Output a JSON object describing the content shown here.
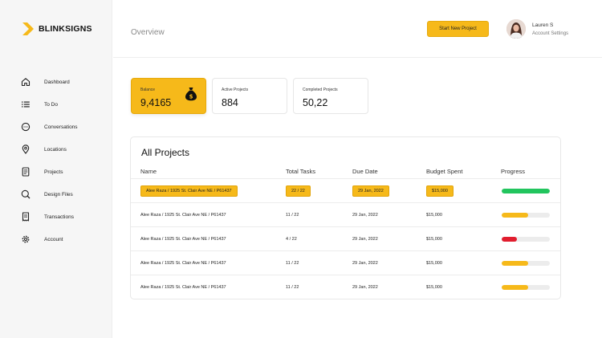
{
  "brand": {
    "name": "BLINKSIGNS",
    "accent": "#f6b91a"
  },
  "sidebar": {
    "items": [
      {
        "label": "Dashboard",
        "icon": "home-icon"
      },
      {
        "label": "To Do",
        "icon": "list-icon"
      },
      {
        "label": "Conversations",
        "icon": "chat-icon"
      },
      {
        "label": "Locations",
        "icon": "location-pin-icon"
      },
      {
        "label": "Projects",
        "icon": "document-icon"
      },
      {
        "label": "Design Files",
        "icon": "file-search-icon"
      },
      {
        "label": "Transactions",
        "icon": "receipt-icon"
      },
      {
        "label": "Account",
        "icon": "gear-icon"
      }
    ]
  },
  "header": {
    "title": "Overview",
    "start_button": "Start New Project",
    "user_name": "Lauren S",
    "user_sub": "Account Settings"
  },
  "stats": {
    "balance": {
      "label": "Balance",
      "value": "9,4165"
    },
    "active": {
      "label": "Active Projects",
      "value": "884"
    },
    "completed": {
      "label": "Completed Projects",
      "value": "50,22"
    }
  },
  "projects": {
    "title": "All Projects",
    "columns": [
      "Name",
      "Total Tasks",
      "Due Date",
      "Budget Spent",
      "Progress"
    ],
    "rows": [
      {
        "name": "Alee Raza / 1925 St. Clair Ave NE / P61437",
        "tasks": "22 / 22",
        "due": "29 Jan, 2022",
        "budget": "$15,000",
        "progress": 1.0,
        "color": "#22c55e",
        "highlight": true
      },
      {
        "name": "Alee Raza / 1925 St. Clair Ave NE / P61437",
        "tasks": "11 / 22",
        "due": "29 Jan, 2022",
        "budget": "$15,000",
        "progress": 0.55,
        "color": "#f6b91a",
        "highlight": false
      },
      {
        "name": "Alee Raza / 1925 St. Clair Ave NE / P61437",
        "tasks": "4 / 22",
        "due": "29 Jan, 2022",
        "budget": "$15,000",
        "progress": 0.32,
        "color": "#e11d2e",
        "highlight": false
      },
      {
        "name": "Alee Raza / 1925 St. Clair Ave NE / P61437",
        "tasks": "11 / 22",
        "due": "29 Jan, 2022",
        "budget": "$15,000",
        "progress": 0.55,
        "color": "#f6b91a",
        "highlight": false
      },
      {
        "name": "Alee Raza / 1925 St. Clair Ave NE / P61437",
        "tasks": "11 / 22",
        "due": "29 Jan, 2022",
        "budget": "$15,000",
        "progress": 0.55,
        "color": "#f6b91a",
        "highlight": false
      }
    ]
  }
}
